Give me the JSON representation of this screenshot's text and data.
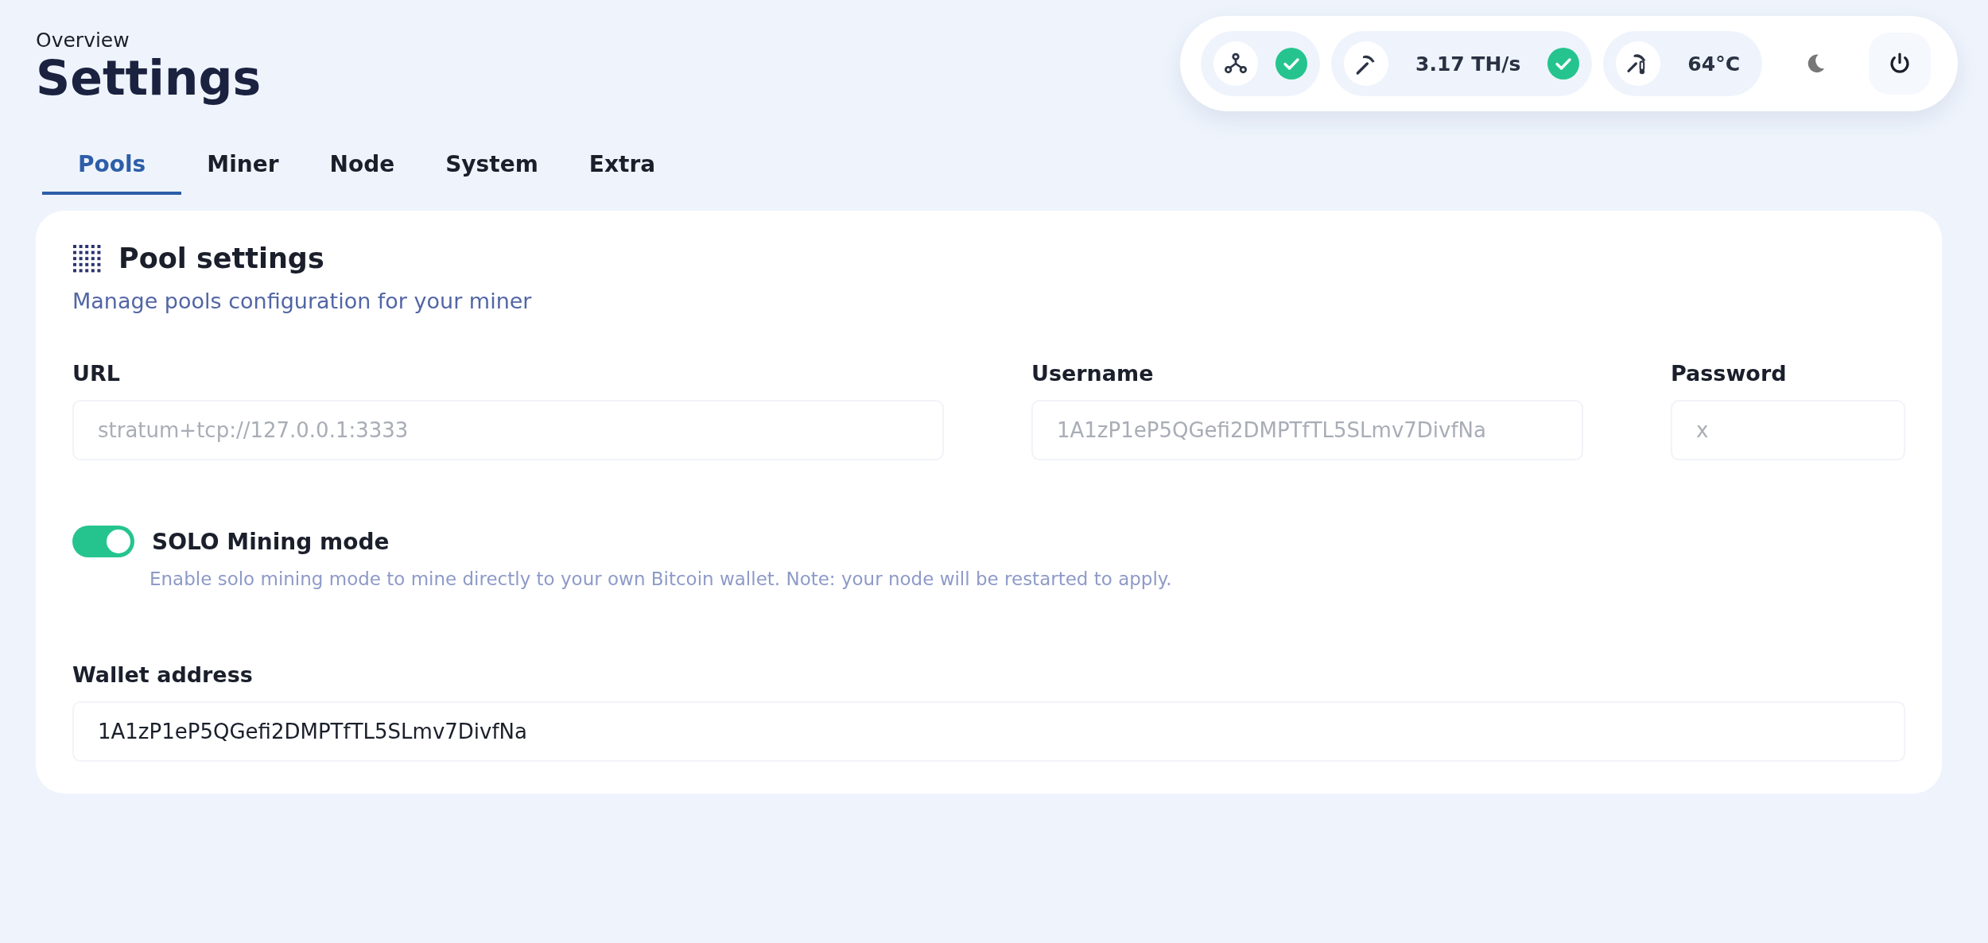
{
  "header": {
    "breadcrumb": "Overview",
    "title": "Settings"
  },
  "status": [
    {
      "kind": "node",
      "ok": true
    },
    {
      "kind": "hashrate",
      "value": "3.17 TH/s",
      "ok": true
    },
    {
      "kind": "temperature",
      "value": "64°C"
    }
  ],
  "tabs": [
    {
      "label": "Pools",
      "selected": true
    },
    {
      "label": "Miner",
      "selected": false
    },
    {
      "label": "Node",
      "selected": false
    },
    {
      "label": "System",
      "selected": false
    },
    {
      "label": "Extra",
      "selected": false
    }
  ],
  "card": {
    "title": "Pool settings",
    "subtitle": "Manage pools configuration for your miner",
    "fields": [
      {
        "label": "URL",
        "value": "stratum+tcp://127.0.0.1:3333",
        "disabled": true
      },
      {
        "label": "Username",
        "value": "1A1zP1eP5QGefi2DMPTfTL5SLmv7DivfNa",
        "disabled": true
      },
      {
        "label": "Password",
        "value": "x",
        "disabled": true
      }
    ],
    "toggle": {
      "label": "SOLO Mining mode",
      "on": true,
      "description": "Enable solo mining mode to mine directly to your own Bitcoin wallet. Note: your node will be restarted to apply."
    },
    "wallet": {
      "label": "Wallet address",
      "value": "1A1zP1eP5QGefi2DMPTfTL5SLmv7DivfNa",
      "disabled": false
    }
  }
}
